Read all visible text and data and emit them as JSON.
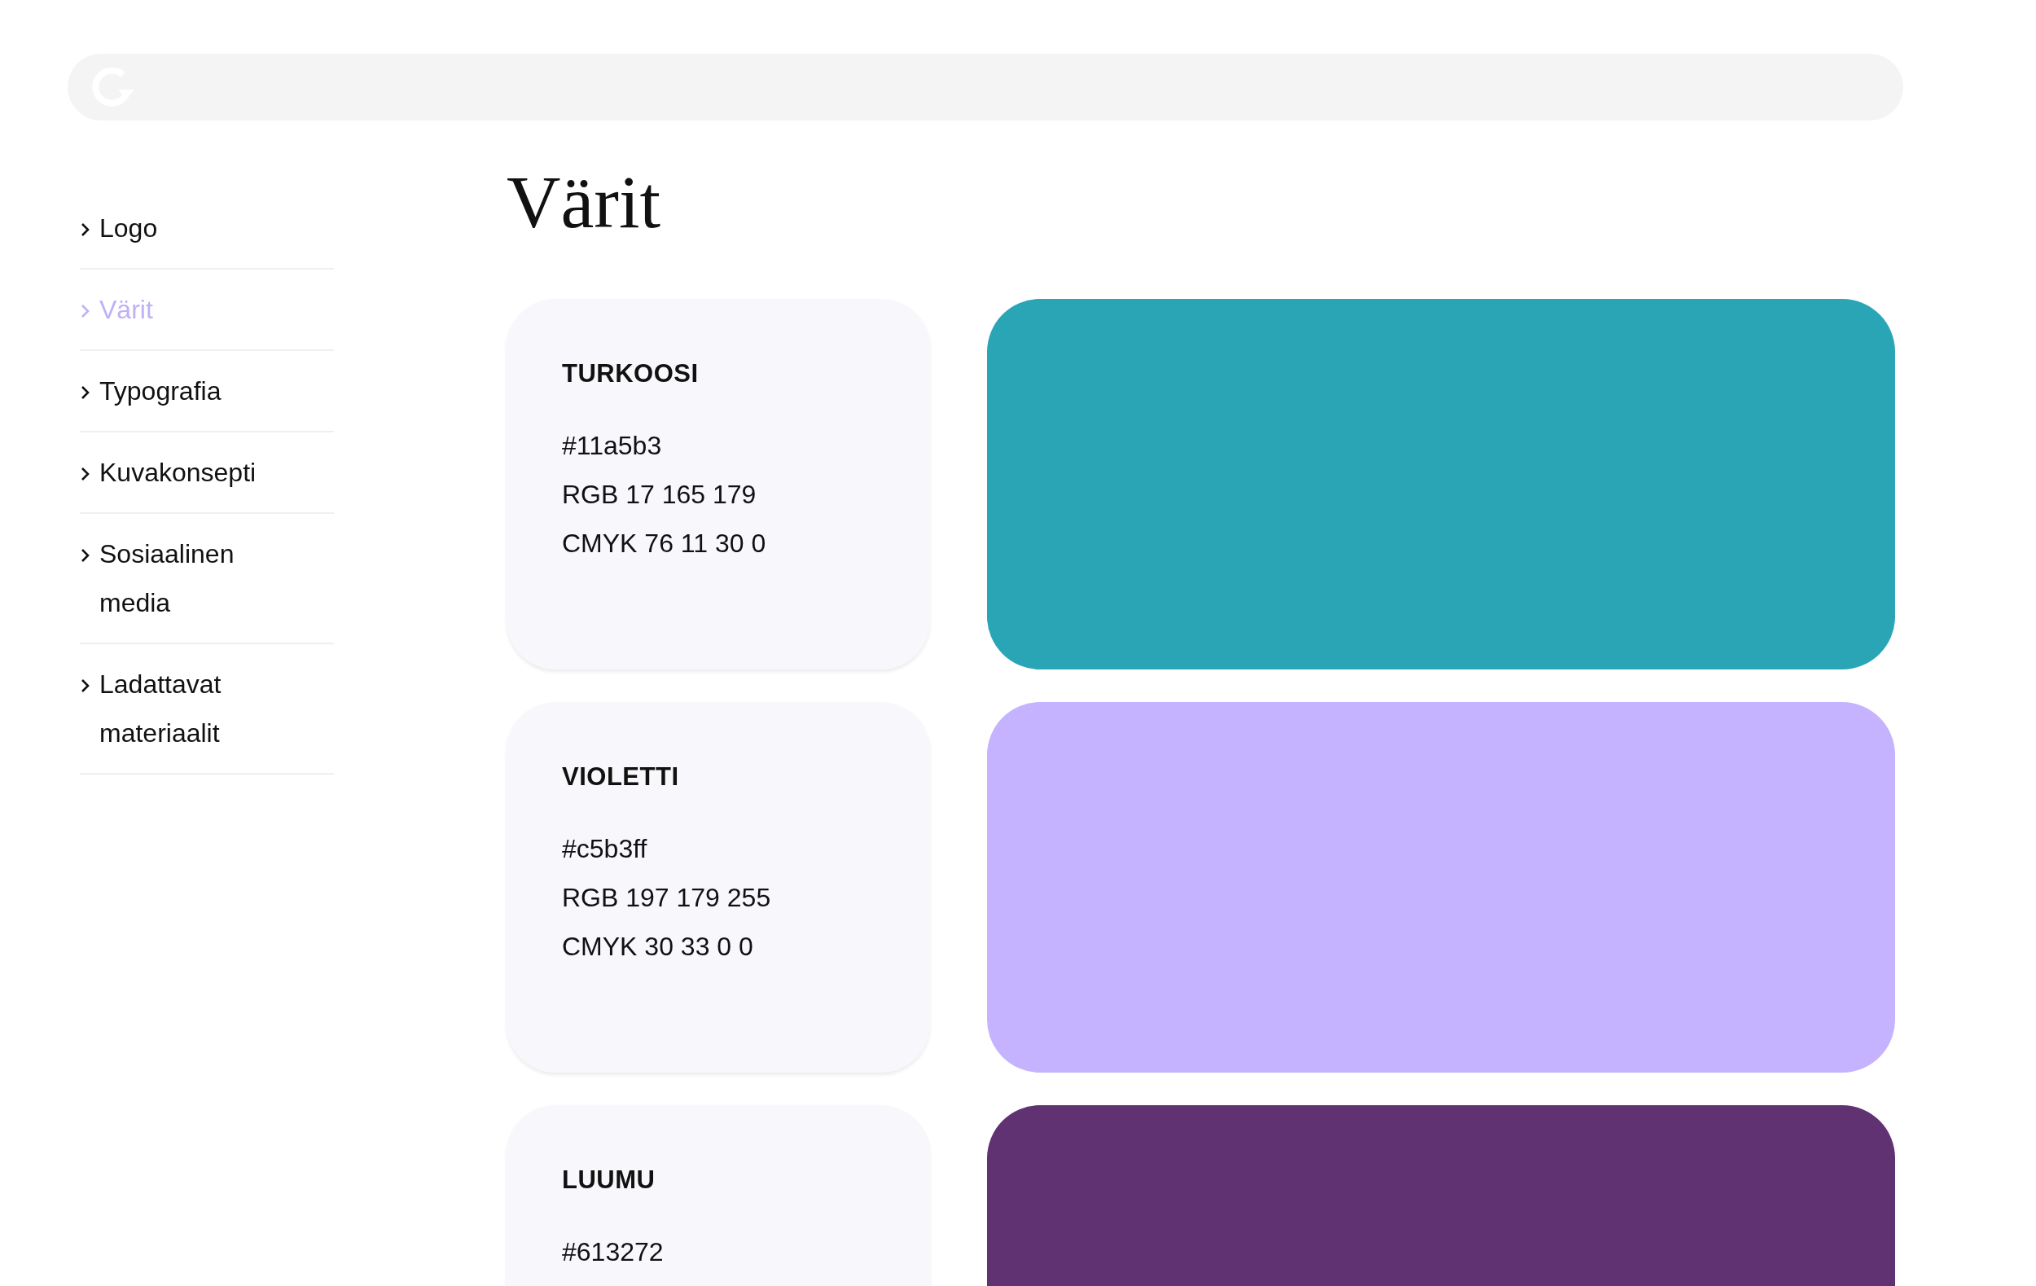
{
  "nav": [
    {
      "label": "Logo",
      "selected": false
    },
    {
      "label": "Värit",
      "selected": true
    },
    {
      "label": "Typografia",
      "selected": false
    },
    {
      "label": "Kuvakonsepti",
      "selected": false
    },
    {
      "label": "Sosiaalinen media",
      "selected": false
    },
    {
      "label": "Ladattavat materiaalit",
      "selected": false
    }
  ],
  "title": "Värit",
  "colors": [
    {
      "name": "TURKOOSI",
      "hex": "#11a5b3",
      "rgb": "RGB 17 165 179",
      "cmyk": "CMYK 76 11 30 0",
      "color": "#2aa5b5"
    },
    {
      "name": "VIOLETTI",
      "hex": "#c5b3ff",
      "rgb": "RGB 197 179 255",
      "cmyk": "CMYK 30 33 0 0",
      "color": "#c5b3ff"
    },
    {
      "name": "LUUMU",
      "hex": "#613272",
      "color": "#613272"
    }
  ]
}
